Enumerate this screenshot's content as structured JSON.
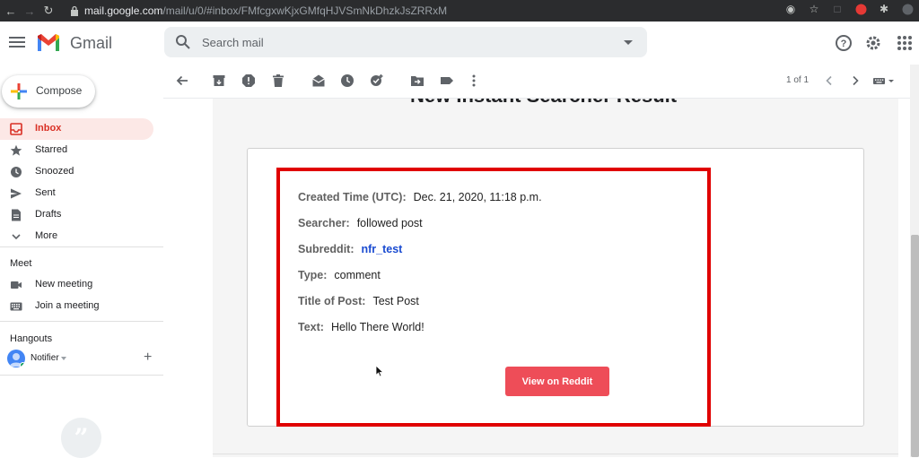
{
  "browser": {
    "url_host": "mail.google.com",
    "url_path": "/mail/u/0/#inbox/FMfcgxwKjxGMfqHJVSmNkDhzkJsZRRxM"
  },
  "header": {
    "app_name": "Gmail",
    "search_placeholder": "Search mail"
  },
  "sidebar": {
    "compose_label": "Compose",
    "items": [
      {
        "label": "Inbox",
        "icon": "inbox-icon"
      },
      {
        "label": "Starred",
        "icon": "star-icon"
      },
      {
        "label": "Snoozed",
        "icon": "clock-icon"
      },
      {
        "label": "Sent",
        "icon": "send-icon"
      },
      {
        "label": "Drafts",
        "icon": "draft-icon"
      },
      {
        "label": "More",
        "icon": "chevron-down-icon"
      }
    ],
    "meet": {
      "title": "Meet",
      "items": [
        {
          "label": "New meeting",
          "icon": "video-icon"
        },
        {
          "label": "Join a meeting",
          "icon": "keyboard-icon"
        }
      ]
    },
    "hangouts": {
      "title": "Hangouts",
      "user": "Notifier"
    }
  },
  "toolbar": {
    "count": "1 of 1"
  },
  "email": {
    "title": "New Instant Searcher Result",
    "fields": [
      {
        "key": "Created Time (UTC):",
        "value": "Dec. 21, 2020, 11:18 p.m.",
        "link": false
      },
      {
        "key": "Searcher:",
        "value": "followed post",
        "link": false
      },
      {
        "key": "Subreddit:",
        "value": "nfr_test",
        "link": true
      },
      {
        "key": "Type:",
        "value": "comment",
        "link": false
      },
      {
        "key": "Title of Post:",
        "value": "Test Post",
        "link": false
      },
      {
        "key": "Text:",
        "value": "Hello There World!",
        "link": false
      }
    ],
    "button_label": "View on Reddit"
  },
  "colors": {
    "highlight_box": "#e00000",
    "reddit_button": "#ee4d58",
    "active_nav": "#fce8e6"
  }
}
